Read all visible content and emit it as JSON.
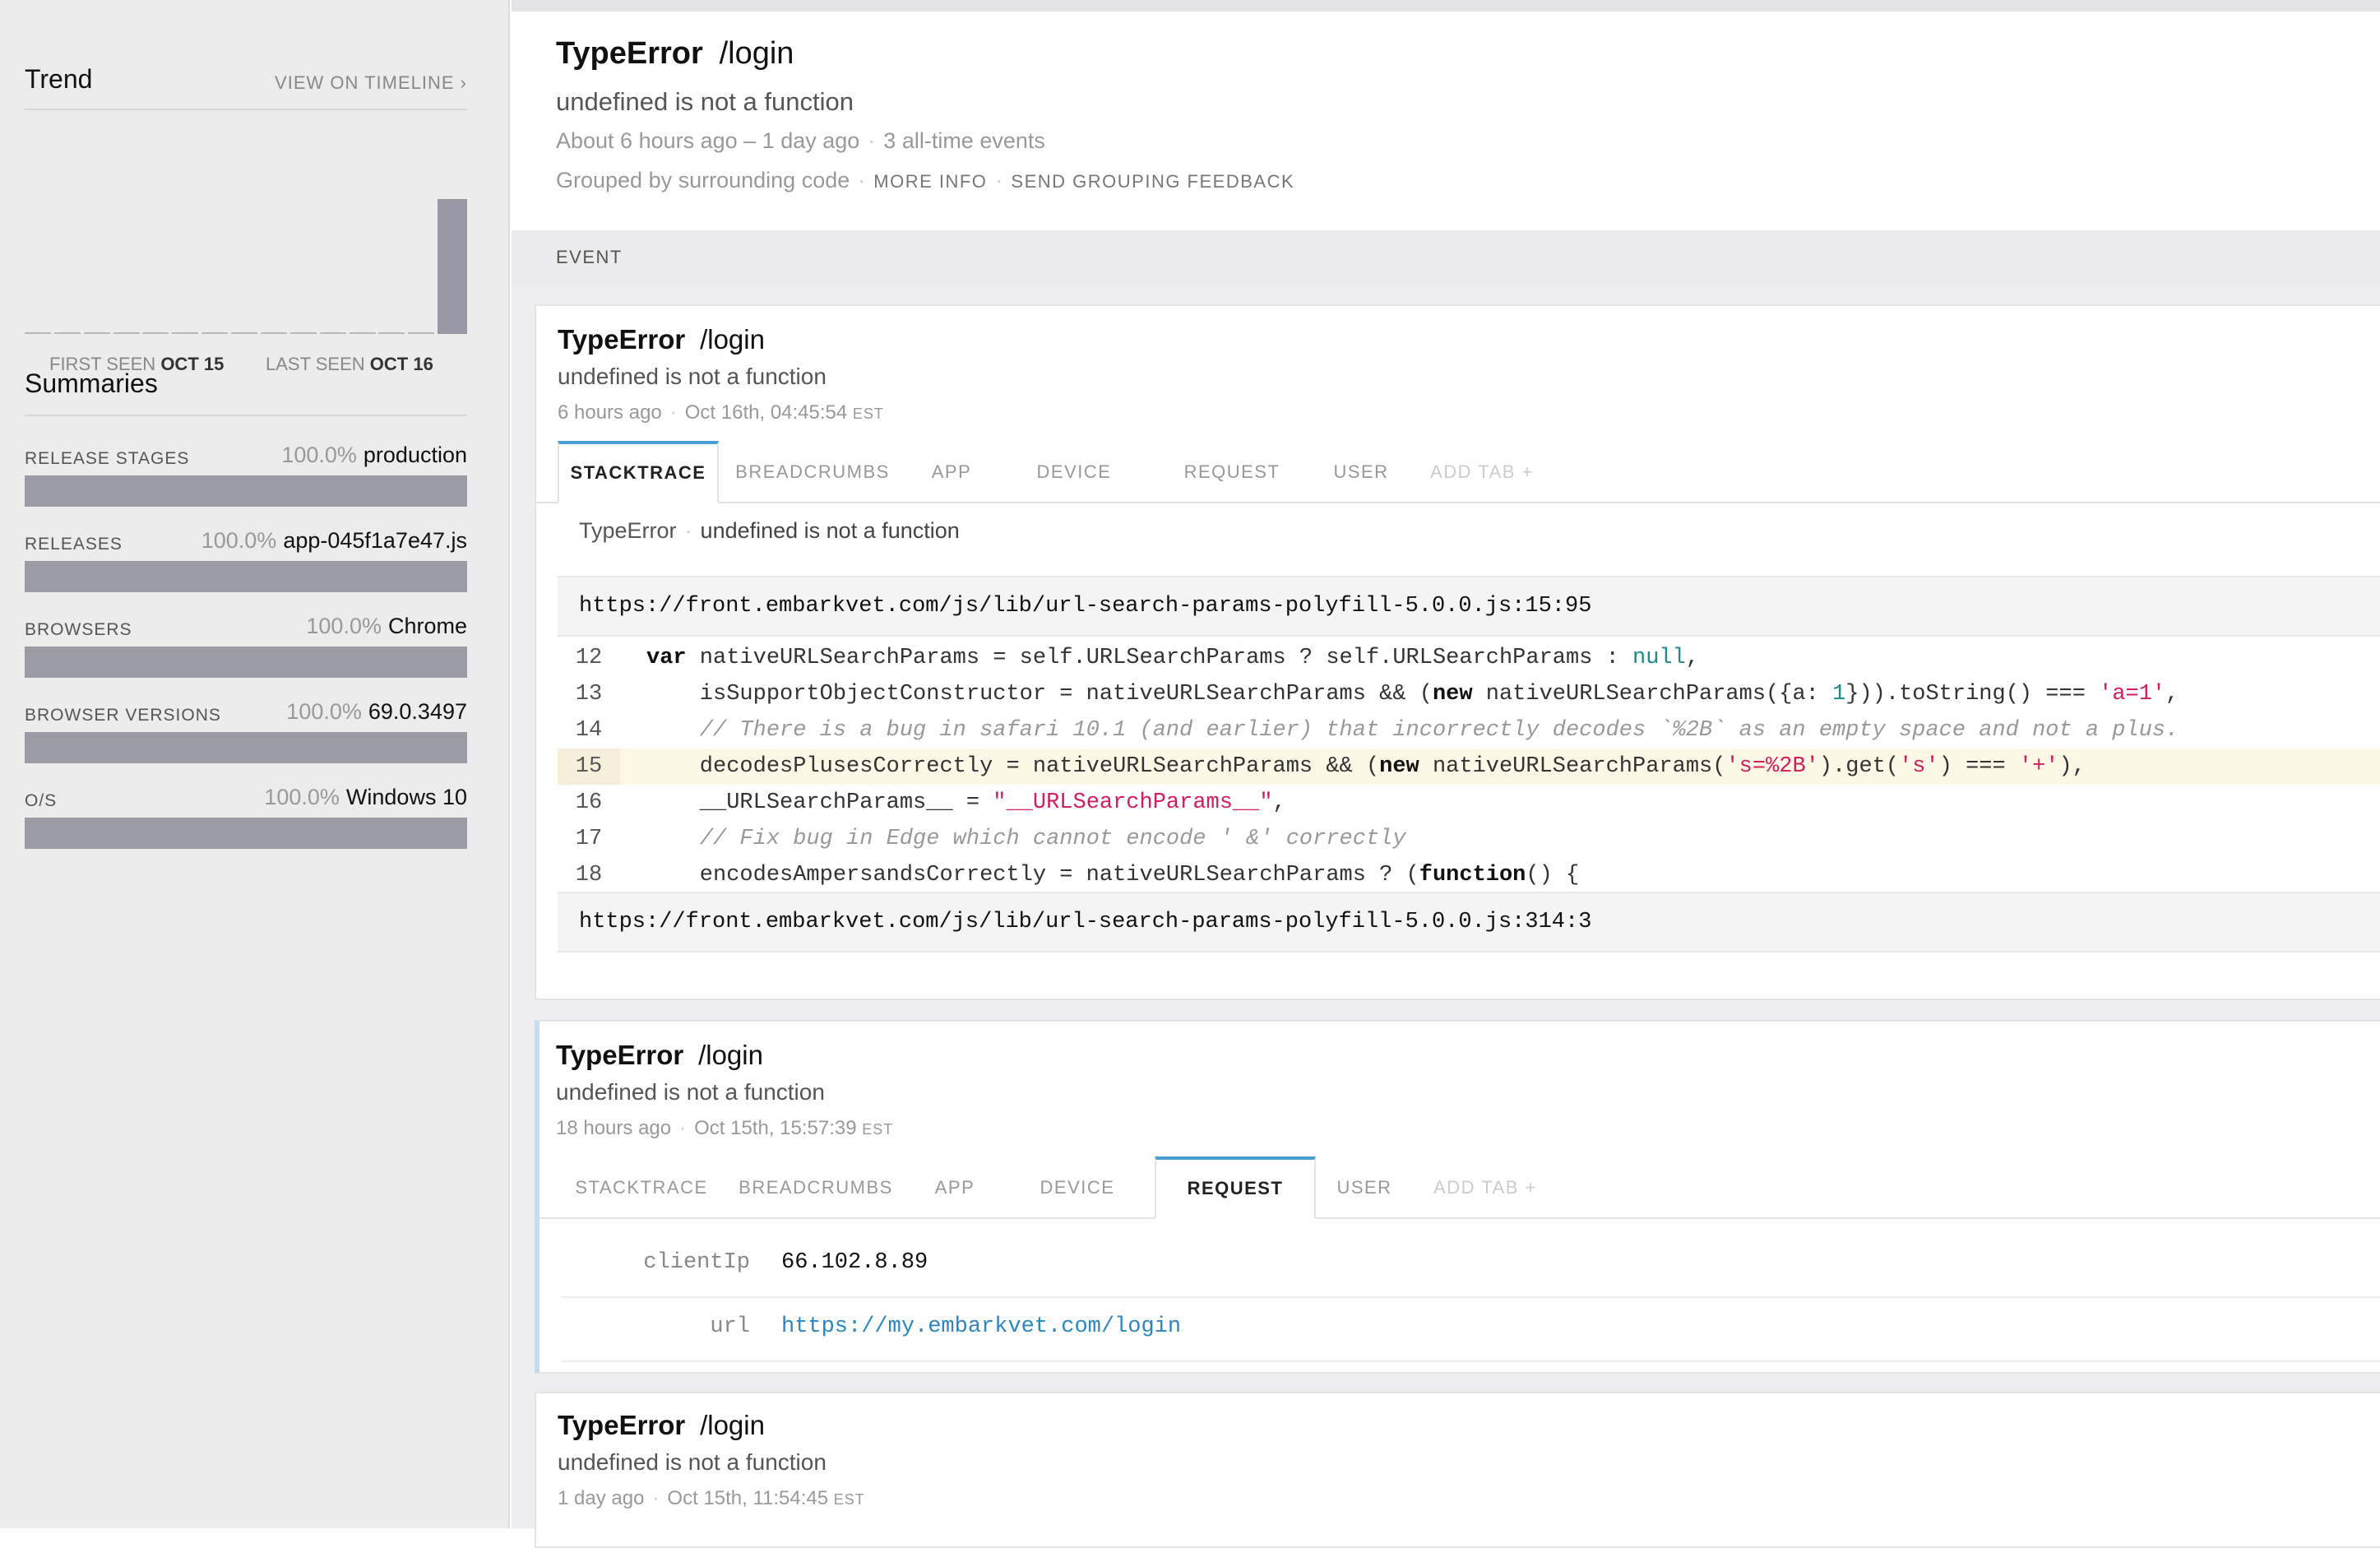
{
  "sidebar": {
    "trend": {
      "title": "Trend",
      "view_link": "VIEW ON TIMELINE ›",
      "bars": [
        0,
        0,
        0,
        0,
        0,
        0,
        0,
        0,
        0,
        0,
        0,
        0,
        0,
        0,
        3
      ],
      "first_seen_label": "FIRST SEEN",
      "first_seen_value": "OCT 15",
      "last_seen_label": "LAST SEEN",
      "last_seen_value": "OCT 16"
    },
    "summaries": {
      "title": "Summaries",
      "rows": [
        {
          "label": "RELEASE STAGES",
          "pct": "100.0%",
          "value": "production"
        },
        {
          "label": "RELEASES",
          "pct": "100.0%",
          "value": "app-045f1a7e47.js"
        },
        {
          "label": "BROWSERS",
          "pct": "100.0%",
          "value": "Chrome"
        },
        {
          "label": "BROWSER VERSIONS",
          "pct": "100.0%",
          "value": "69.0.3497"
        },
        {
          "label": "O/S",
          "pct": "100.0%",
          "value": "Windows 10"
        }
      ]
    }
  },
  "header": {
    "error_class": "TypeError",
    "context": "/login",
    "message": "undefined is not a function",
    "time_range": "About 6 hours ago – 1 day ago",
    "events": "3 all-time events",
    "grouping": "Grouped by surrounding code",
    "more_info": "MORE INFO",
    "send_feedback": "SEND GROUPING FEEDBACK"
  },
  "event_section_label": "EVENT",
  "tabs": [
    "STACKTRACE",
    "BREADCRUMBS",
    "APP",
    "DEVICE",
    "REQUEST",
    "USER",
    "ADD TAB +"
  ],
  "events": [
    {
      "error_class": "TypeError",
      "context": "/login",
      "message": "undefined is not a function",
      "relative": "6 hours ago",
      "timestamp": "Oct 16th, 04:45:54",
      "tz": "EST",
      "active_tab": "STACKTRACE",
      "stack_error": "TypeError",
      "stack_message": "undefined is not a function",
      "frame1": "https://front.embarkvet.com/js/lib/url-search-params-polyfill-5.0.0.js:15:95",
      "frame2": "https://front.embarkvet.com/js/lib/url-search-params-polyfill-5.0.0.js:314:3",
      "code_lines": [
        "12",
        "13",
        "14",
        "15",
        "16",
        "17",
        "18"
      ],
      "highlight_line": "15"
    },
    {
      "error_class": "TypeError",
      "context": "/login",
      "message": "undefined is not a function",
      "relative": "18 hours ago",
      "timestamp": "Oct 15th, 15:57:39",
      "tz": "EST",
      "active_tab": "REQUEST",
      "request": {
        "client_ip_key": "clientIp",
        "client_ip_value": "66.102.8.89",
        "url_key": "url",
        "url_value": "https://my.embarkvet.com/login"
      }
    },
    {
      "error_class": "TypeError",
      "context": "/login",
      "message": "undefined is not a function",
      "relative": "1 day ago",
      "timestamp": "Oct 15th, 11:54:45",
      "tz": "EST"
    }
  ],
  "colors": {
    "active_tab_accent": "#4a9fd8",
    "summary_bar": "#9b9ba6",
    "string": "#d21f5c",
    "link": "#2a87c4",
    "highlight_row": "#fdf7e6"
  }
}
